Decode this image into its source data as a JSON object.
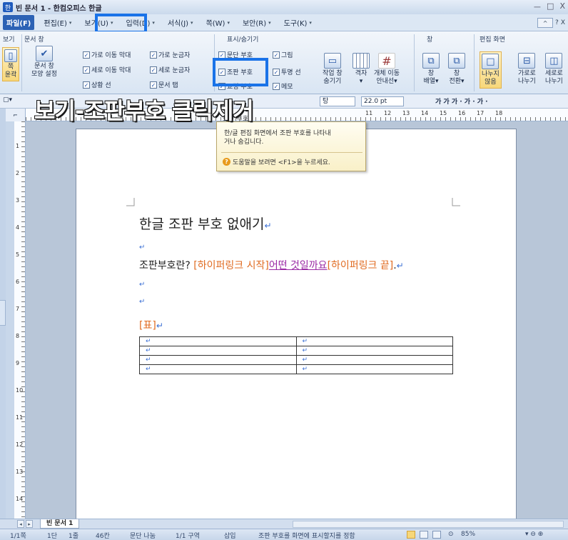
{
  "window": {
    "title": "빈 문서 1 - 한컴오피스 한글",
    "app_icon": "한",
    "controls": [
      "ㅡ",
      "□",
      "X"
    ]
  },
  "menu": {
    "items": [
      {
        "label": "파일(F)",
        "caret": ""
      },
      {
        "label": "편집(E)",
        "caret": "▾"
      },
      {
        "label": "보기(U)",
        "caret": "▾"
      },
      {
        "label": "입력(D)",
        "caret": "▾"
      },
      {
        "label": "서식(J)",
        "caret": "▾"
      },
      {
        "label": "쪽(W)",
        "caret": "▾"
      },
      {
        "label": "보안(R)",
        "caret": "▾"
      },
      {
        "label": "도구(K)",
        "caret": "▾"
      }
    ],
    "right_controls": {
      "collapse": "^",
      "help": "?",
      "close": "X"
    }
  },
  "ribbon": {
    "groups": {
      "view": "보기",
      "doc_window": "문서 창",
      "show_hide": "표시/숨기기",
      "window": "창",
      "edit_screen": "편집 화면"
    },
    "left_buttons": {
      "page_outline": "쪽\n윤곽",
      "doc_window_shape": "문서 창\n모양 설정"
    },
    "checkboxes": [
      {
        "label": "가로 이동 막대",
        "checked": true
      },
      {
        "label": "가로 눈금자",
        "checked": true
      },
      {
        "label": "세로 이동 막대",
        "checked": true
      },
      {
        "label": "세로 눈금자",
        "checked": true
      },
      {
        "label": "상황 선",
        "checked": true
      },
      {
        "label": "문서 탭",
        "checked": true
      },
      {
        "label": "문단 부호",
        "checked": true
      },
      {
        "label": "그림",
        "checked": true
      },
      {
        "label": "조판 부호",
        "checked": true
      },
      {
        "label": "투명 선",
        "checked": true
      },
      {
        "label": "교정 부호",
        "checked": true
      },
      {
        "label": "메모",
        "checked": true
      }
    ],
    "buttons": {
      "hide_work_window": "작업 창\n숨기기",
      "grid": "격자\n▾",
      "object_move_guide": "개체 이동\n안내선▾",
      "window_arrange": "창\n배열▾",
      "window_switch": "창\n전환▾",
      "no_split": "나누지\n않음",
      "split_horizontal": "가로로\n나누기",
      "split_vertical": "세로로\n나누기"
    }
  },
  "toolbar": {
    "style_field": "탕",
    "size_value": "22.0",
    "size_unit": "pt",
    "format_buttons": "가 가 가 · 가 · 가 ·"
  },
  "caption": "보기-조판부호 클릭제거",
  "ruler": {
    "h_numbers": [
      "11",
      "12",
      "13",
      "14",
      "15",
      "16",
      "17",
      "18"
    ],
    "v_numbers": [
      "1",
      "2",
      "3",
      "4",
      "5",
      "6",
      "7",
      "8",
      "9",
      "10",
      "11",
      "12",
      "13",
      "14"
    ],
    "corner": "⌐"
  },
  "tooltip": {
    "header": "조판 부호",
    "body": "한/글 편집 화면에서 조판 부호를 나타내거나 숨깁니다.",
    "help_icon": "?",
    "help_text": "도움말을 보려면 <F1>을 누르세요."
  },
  "document": {
    "title": "한글 조판 부호 없애기",
    "line_prefix": "조판부호란? ",
    "hyperlink_start": "[하이퍼링크 시작]",
    "link_text": "어떤 것일까요",
    "hyperlink_end": "[하이퍼링크 끝]",
    "line_suffix": ".",
    "table_code": "[표]",
    "para_mark": "↵",
    "table_rows": [
      [
        "↵",
        "↵"
      ],
      [
        "↵",
        "↵"
      ],
      [
        "↵",
        "↵"
      ],
      [
        "↵",
        "↵"
      ]
    ]
  },
  "tabs": {
    "doc_tab": "빈 문서 1",
    "nav_prev": "◂",
    "nav_next": "▸"
  },
  "status": {
    "page": "1/1쪽",
    "section": "1단",
    "line": "1줄",
    "column": "46칸",
    "paragraph": "문단 나눔",
    "block": "1/1 구역",
    "mode": "삽입",
    "message": "조판 부호를 화면에 표시할지를 정함",
    "zoom": "85%"
  },
  "colors": {
    "highlight": "#1a73e8",
    "hyperlink_code": "#e06b21",
    "link": "#9a2aa4",
    "para_mark": "#3a6fd4"
  }
}
